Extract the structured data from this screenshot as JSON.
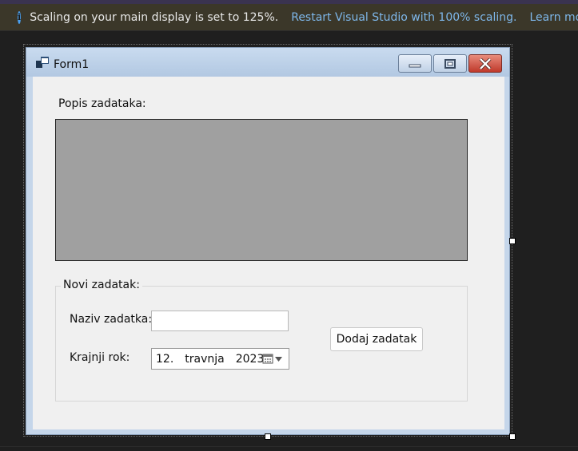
{
  "infobar": {
    "message": "Scaling on your main display is set to 125%.",
    "restart_link": "Restart Visual Studio with 100% scaling.",
    "learn_more": "Learn more..."
  },
  "form": {
    "title": "Form1",
    "list_label": "Popis zadataka:",
    "group_label": "Novi zadatak:",
    "name_label": "Naziv zadatka:",
    "name_value": "",
    "deadline_label": "Krajnji rok:",
    "date": {
      "day": "12.",
      "month": "travnja",
      "year": "2023."
    },
    "add_button": "Dodaj zadatak"
  },
  "colors": {
    "infobar_bg": "#3b3729",
    "link": "#7eb7ea",
    "listbox_bg": "#a0a0a0",
    "close_button": "#c0392b"
  },
  "icons": [
    "info-icon",
    "form-icon",
    "minimize-icon",
    "maximize-icon",
    "close-icon",
    "calendar-icon",
    "dropdown-arrow-icon"
  ]
}
